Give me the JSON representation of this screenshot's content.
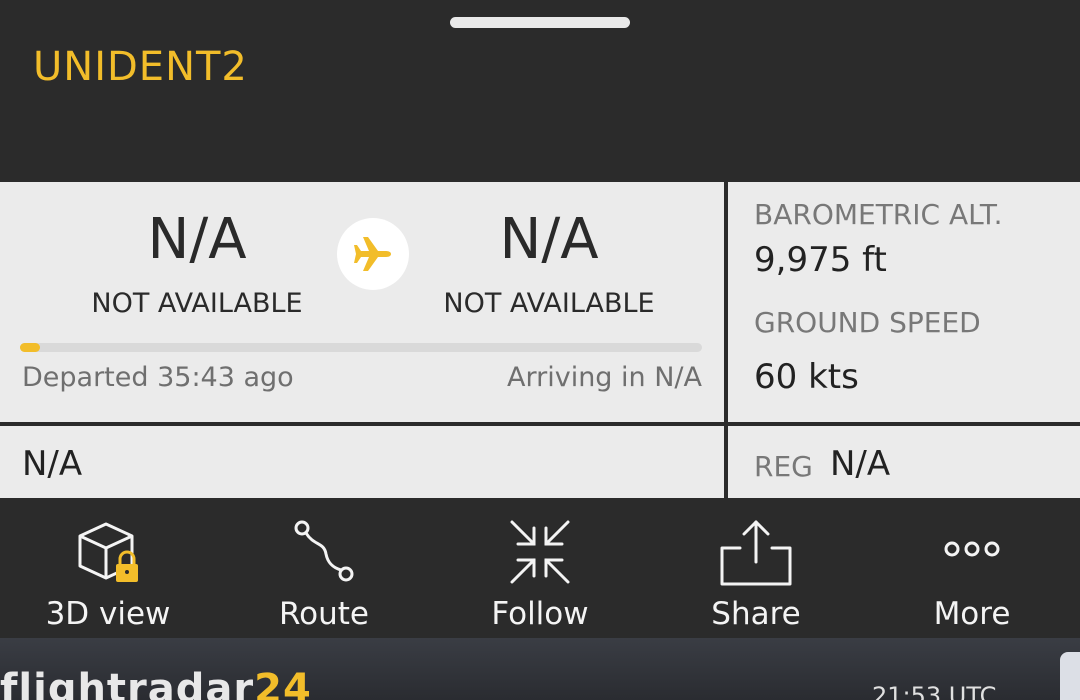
{
  "flight": {
    "callsign": "UNIDENT2"
  },
  "route": {
    "origin_code": "N/A",
    "origin_name": "NOT AVAILABLE",
    "destination_code": "N/A",
    "destination_name": "NOT AVAILABLE",
    "progress_percent": 3,
    "departed_text": "Departed 35:43 ago",
    "arriving_text": "Arriving in N/A"
  },
  "stats": {
    "baro_label": "BAROMETRIC ALT.",
    "baro_value": "9,975 ft",
    "speed_label": "GROUND SPEED",
    "speed_value": "60 kts"
  },
  "details": {
    "aircraft_type": "N/A",
    "reg_label": "REG",
    "reg_value": "N/A"
  },
  "toolbar": {
    "view3d_label": "3D view",
    "route_label": "Route",
    "follow_label": "Follow",
    "share_label": "Share",
    "more_label": "More"
  },
  "footer": {
    "brand_text": "flightradar",
    "brand_accent": "24",
    "clock": "21:53 UTC"
  },
  "colors": {
    "accent": "#f2bd2a",
    "panel": "#ebebeb",
    "dark": "#2b2b2b"
  }
}
